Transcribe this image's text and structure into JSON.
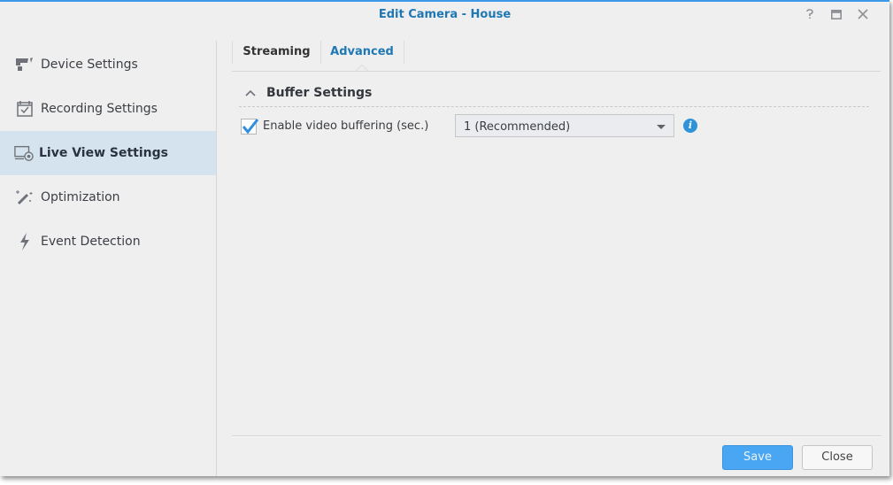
{
  "window": {
    "title": "Edit Camera - House",
    "controls": [
      {
        "name": "help",
        "icon": "question-icon"
      },
      {
        "name": "maximize",
        "icon": "maximize-icon"
      },
      {
        "name": "close",
        "icon": "close-icon"
      }
    ],
    "accent": "#3b9ae8"
  },
  "sidebar": {
    "items": [
      {
        "label": "Device Settings",
        "icon": "camera-icon",
        "active": false
      },
      {
        "label": "Recording Settings",
        "icon": "calendar-check-icon",
        "active": false
      },
      {
        "label": "Live View Settings",
        "icon": "monitor-camera-icon",
        "active": true
      },
      {
        "label": "Optimization",
        "icon": "magic-wand-icon",
        "active": false
      },
      {
        "label": "Event Detection",
        "icon": "lightning-icon",
        "active": false
      }
    ]
  },
  "tabs": [
    {
      "label": "Streaming",
      "active": false
    },
    {
      "label": "Advanced",
      "active": true
    }
  ],
  "section": {
    "title": "Buffer Settings",
    "expanded": true
  },
  "buffering": {
    "checkbox_label": "Enable video buffering (sec.)",
    "checked": true,
    "selected_value": "1 (Recommended)",
    "info_icon": "i"
  },
  "footer": {
    "save_label": "Save",
    "close_label": "Close"
  }
}
